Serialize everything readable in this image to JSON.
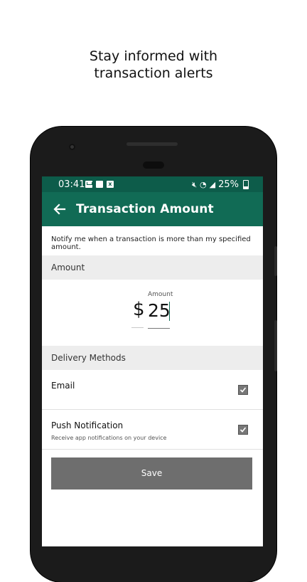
{
  "headline": {
    "line1": "Stay informed with",
    "line2": "transaction alerts"
  },
  "statusbar": {
    "time": "03:41",
    "battery": "25%"
  },
  "appbar": {
    "title": "Transaction Amount"
  },
  "notice": "Notify me when a transaction is more than my specified amount.",
  "amount_section": {
    "header": "Amount",
    "currency": "$",
    "field_label": "Amount",
    "value": "25"
  },
  "delivery": {
    "header": "Delivery Methods",
    "methods": [
      {
        "label": "Email",
        "sub": "",
        "checked": true
      },
      {
        "label": "Push Notification",
        "sub": "Receive app notifications on your device",
        "checked": true
      }
    ]
  },
  "save_label": "Save",
  "colors": {
    "brand": "#116b55",
    "statusbar": "#0d5c4a",
    "button": "#6e6e6e"
  }
}
